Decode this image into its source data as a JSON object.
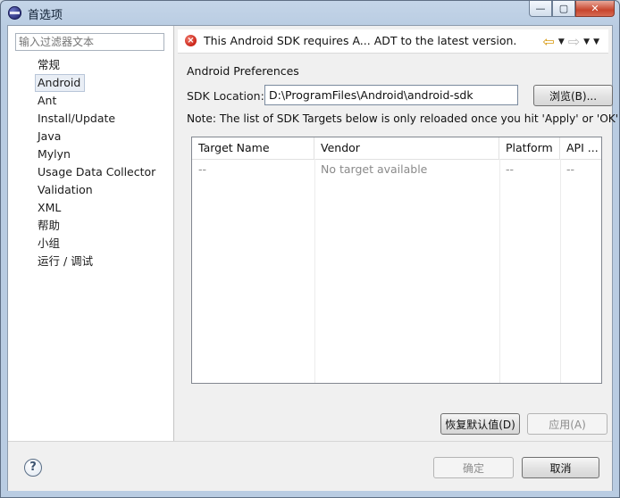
{
  "window": {
    "title": "首选项",
    "minimize_glyph": "—",
    "maximize_glyph": "▢",
    "close_glyph": "✕"
  },
  "sidebar": {
    "filter_placeholder": "输入过滤器文本",
    "items": [
      {
        "label": "常规"
      },
      {
        "label": "Android",
        "selected": true
      },
      {
        "label": "Ant"
      },
      {
        "label": "Install/Update"
      },
      {
        "label": "Java"
      },
      {
        "label": "Mylyn"
      },
      {
        "label": "Usage Data Collector"
      },
      {
        "label": "Validation"
      },
      {
        "label": "XML"
      },
      {
        "label": "帮助"
      },
      {
        "label": "小组"
      },
      {
        "label": "运行 / 调试"
      }
    ]
  },
  "message": {
    "text": "This Android SDK requires A... ADT to the latest version.",
    "icon": "error-icon",
    "back_glyph": "⇦",
    "forward_glyph": "⇨",
    "dropdown_glyph": "▼"
  },
  "page": {
    "title": "Android Preferences",
    "sdk_label": "SDK Location:",
    "sdk_value": "D:\\ProgramFiles\\Android\\android-sdk",
    "browse_label": "浏览(B)...",
    "note": "Note: The list of SDK Targets below is only reloaded once you hit 'Apply' or 'OK'.",
    "table": {
      "headers": [
        "Target Name",
        "Vendor",
        "Platform",
        "API ..."
      ],
      "rows": [
        [
          "--",
          "No target available",
          "--",
          "--"
        ]
      ]
    },
    "restore_defaults_label": "恢复默认值(D)",
    "apply_label": "应用(A)"
  },
  "footer": {
    "help_glyph": "?",
    "ok_label": "确定",
    "cancel_label": "取消"
  },
  "colors": {
    "error": "#c81e12",
    "nav_back": "#d89a12",
    "disabled_text": "#8d8d8d"
  }
}
